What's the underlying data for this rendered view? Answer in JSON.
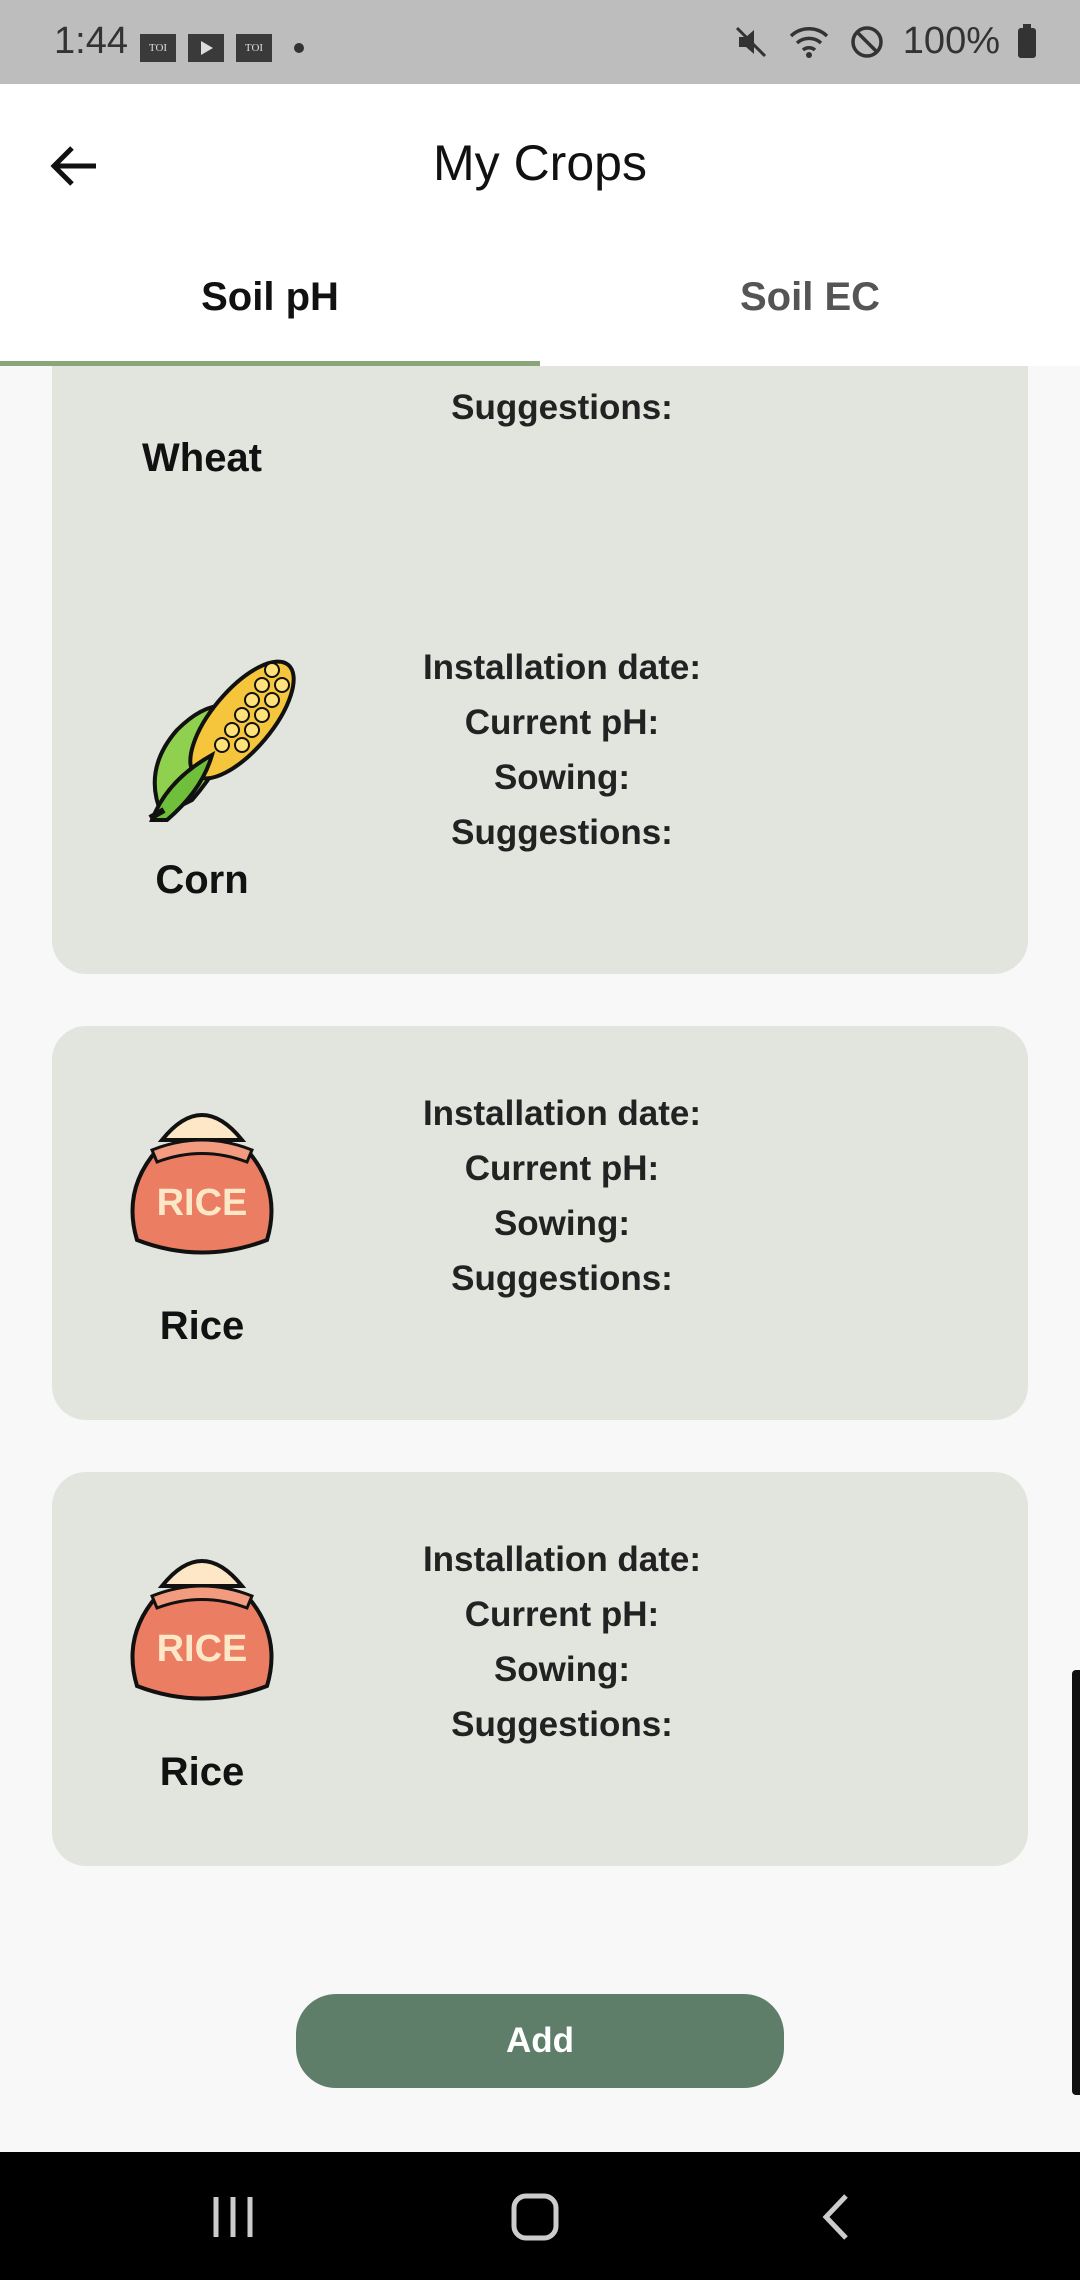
{
  "status_bar": {
    "time": "1:44",
    "notification_icons": [
      "TOI",
      "youtube-icon",
      "TOI"
    ],
    "battery": "100%"
  },
  "header": {
    "title": "My Crops",
    "back_icon": "arrow-left-icon"
  },
  "tabs": [
    {
      "label": "Soil pH",
      "active": true
    },
    {
      "label": "Soil EC",
      "active": false
    }
  ],
  "cards": [
    {
      "name": "Wheat",
      "icon": "wheat-icon",
      "fields": [
        "Suggestions:"
      ]
    },
    {
      "name": "Corn",
      "icon": "corn-icon",
      "fields": [
        "Installation date:",
        "Current pH:",
        "Sowing:",
        "Suggestions:"
      ]
    },
    {
      "name": "Rice",
      "icon": "rice-sack-icon",
      "icon_text": "RICE",
      "fields": [
        "Installation date:",
        "Current pH:",
        "Sowing:",
        "Suggestions:"
      ]
    },
    {
      "name": "Rice",
      "icon": "rice-sack-icon",
      "icon_text": "RICE",
      "fields": [
        "Installation date:",
        "Current pH:",
        "Sowing:",
        "Suggestions:"
      ]
    }
  ],
  "add_button": {
    "label": "Add"
  },
  "colors": {
    "accent": "#8aa678",
    "card_bg": "#e1e5de",
    "button_bg": "#5e7e6a"
  }
}
